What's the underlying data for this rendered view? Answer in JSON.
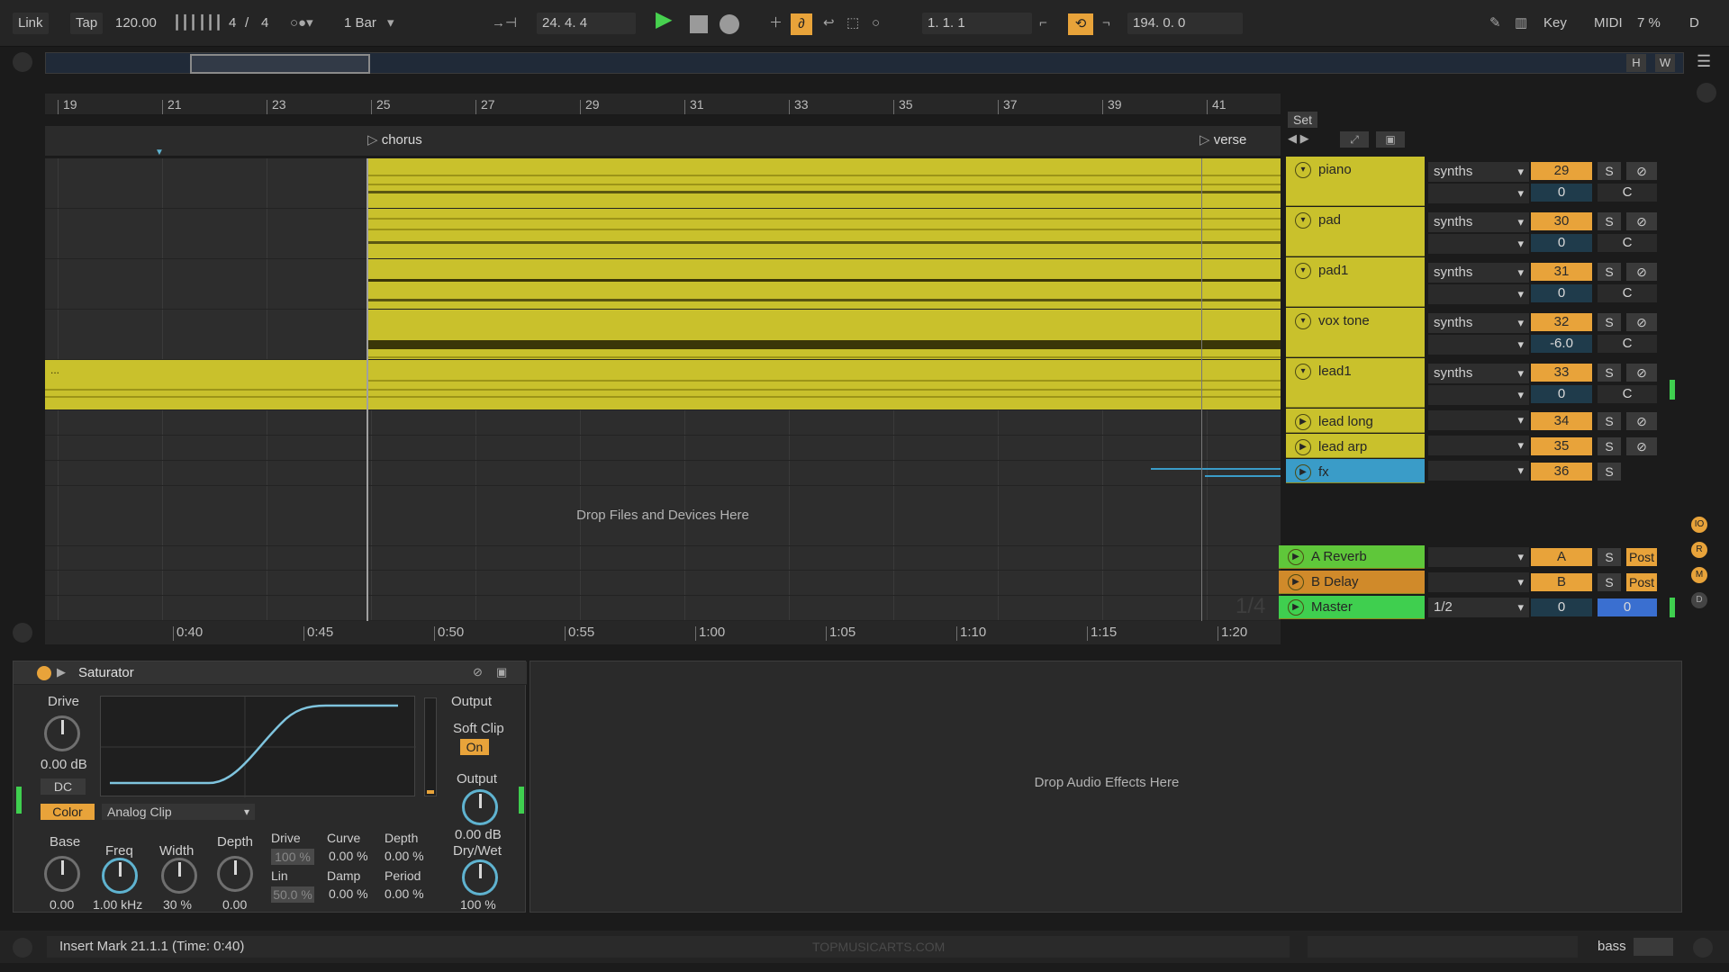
{
  "toolbar": {
    "link": "Link",
    "tap": "Tap",
    "tempo": "120.00",
    "time_sig_num": "4",
    "time_sig_sep": "/",
    "time_sig_den": "4",
    "quantize": "1 Bar",
    "position": "24.   4.   4",
    "loop_start": "1.   1.   1",
    "loop_length": "194.   0.   0",
    "key": "Key",
    "midi": "MIDI",
    "cpu": "7 %",
    "d": "D",
    "h": "H",
    "w": "W"
  },
  "ruler": {
    "bars": [
      "19",
      "21",
      "23",
      "25",
      "27",
      "29",
      "31",
      "33",
      "35",
      "37",
      "39",
      "41"
    ]
  },
  "locators": {
    "chorus": "chorus",
    "verse": "verse"
  },
  "set_label": "Set",
  "arrangement": {
    "drop_files": "Drop Files and Devices Here",
    "ellipsis": "..."
  },
  "time_ruler": {
    "times": [
      "0:40",
      "0:45",
      "0:50",
      "0:55",
      "1:00",
      "1:05",
      "1:10",
      "1:15",
      "1:20"
    ]
  },
  "tracks": [
    {
      "name": "piano",
      "group": "synths",
      "num": "29",
      "vol": "0",
      "pan": "C"
    },
    {
      "name": "pad",
      "group": "synths",
      "num": "30",
      "vol": "0",
      "pan": "C"
    },
    {
      "name": "pad1",
      "group": "synths",
      "num": "31",
      "vol": "0",
      "pan": "C"
    },
    {
      "name": "vox tone",
      "group": "synths",
      "num": "32",
      "vol": "-6.0",
      "pan": "C"
    },
    {
      "name": "lead1",
      "group": "synths",
      "num": "33",
      "vol": "0",
      "pan": "C"
    },
    {
      "name": "lead long",
      "num": "34"
    },
    {
      "name": "lead arp",
      "num": "35"
    },
    {
      "name": "fx",
      "num": "36"
    }
  ],
  "returns": [
    {
      "name": "A Reverb",
      "letter": "A",
      "post": "Post"
    },
    {
      "name": "B Delay",
      "letter": "B",
      "post": "Post"
    }
  ],
  "master": {
    "name": "Master",
    "select": "1/2",
    "vol": "0",
    "pan": "0"
  },
  "solo": "S",
  "page_indicator": "1/4",
  "device": {
    "name": "Saturator",
    "drive_label": "Drive",
    "drive_value": "0.00 dB",
    "dc": "DC",
    "color": "Color",
    "mode": "Analog Clip",
    "output_label": "Output",
    "soft_clip": "Soft Clip",
    "soft_clip_state": "On",
    "output_knob_label": "Output",
    "output_value": "0.00 dB",
    "drywet_label": "Dry/Wet",
    "drywet_value": "100 %",
    "base_label": "Base",
    "base_value": "0.00",
    "freq_label": "Freq",
    "freq_value": "1.00 kHz",
    "width_label": "Width",
    "width_value": "30 %",
    "depth_label": "Depth",
    "depth_value": "0.00",
    "ws_drive_label": "Drive",
    "ws_drive_value": "100 %",
    "ws_curve_label": "Curve",
    "ws_curve_value": "0.00 %",
    "ws_depth_label": "Depth",
    "ws_depth_value": "0.00 %",
    "ws_lin_label": "Lin",
    "ws_lin_value": "50.0 %",
    "ws_damp_label": "Damp",
    "ws_damp_value": "0.00 %",
    "ws_period_label": "Period",
    "ws_period_value": "0.00 %"
  },
  "fx_drop": "Drop Audio Effects Here",
  "status": {
    "message": "Insert Mark 21.1.1 (Time: 0:40)",
    "watermark": "TOPMUSICARTS.COM",
    "track": "bass"
  },
  "colors": {
    "clip": "#c9c12c",
    "accent_orange": "#e8a33a",
    "fx_blue": "#3a9cc8",
    "reverb_green": "#5fc73a",
    "delay_orange": "#d08a2a",
    "master_green": "#3fcf4f"
  }
}
